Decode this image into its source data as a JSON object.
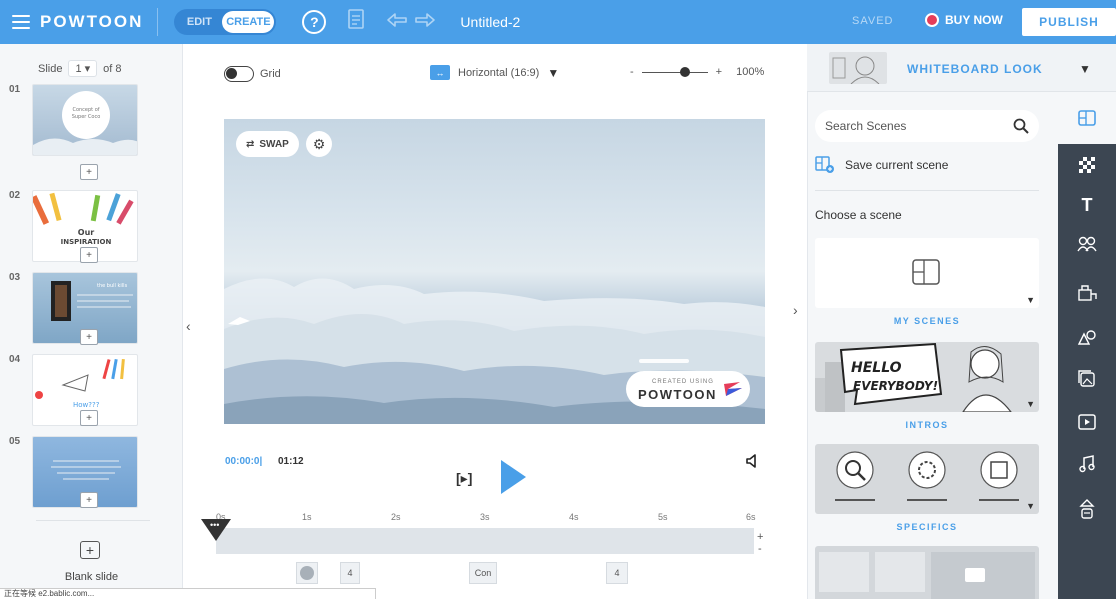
{
  "topbar": {
    "logo": "POWTOON",
    "mode_edit": "EDIT",
    "mode_create": "CREATE",
    "help": "?",
    "title": "Untitled-2",
    "saved": "SAVED",
    "buy_now": "BUY NOW",
    "publish": "PUBLISH"
  },
  "slides_panel": {
    "label": "Slide",
    "current": "1",
    "total": "of 8",
    "slides": [
      {
        "num": "01",
        "text": "Concept of Super Coco"
      },
      {
        "num": "02",
        "text": "Our INSPIRATION"
      },
      {
        "num": "03",
        "text": "the bull kills"
      },
      {
        "num": "04",
        "text": "How???"
      },
      {
        "num": "05",
        "text": ""
      }
    ],
    "blank_slide": "Blank slide"
  },
  "canvas": {
    "grid_label": "Grid",
    "orientation": "Horizontal (16:9)",
    "zoom_minus": "-",
    "zoom_plus": "+",
    "zoom_value": "100%",
    "swap_label": "SWAP",
    "watermark_top": "CREATED USING",
    "watermark_main": "POWTOON"
  },
  "playback": {
    "current_time": "00:00:0|",
    "total_time": "01:12",
    "preview": "[▸]"
  },
  "timeline": {
    "ticks": [
      "0s",
      "1s",
      "2s",
      "3s",
      "4s",
      "5s",
      "6s"
    ],
    "plus": "+",
    "minus": "-",
    "items": [
      "",
      "4",
      "Con",
      "4"
    ]
  },
  "status_bar": "正在等候 e2.bablic.com...",
  "scenes_panel": {
    "look": "WHITEBOARD LOOK",
    "search_placeholder": "Search Scenes",
    "save_scene": "Save current scene",
    "choose": "Choose a scene",
    "categories": [
      "MY SCENES",
      "INTROS",
      "SPECIFICS"
    ],
    "intro_text_1": "HELLO",
    "intro_text_2": "EVERYBODY!"
  },
  "toolbar_icons": [
    "scenes-icon",
    "backgrounds-icon",
    "text-icon",
    "characters-icon",
    "props-icon",
    "shapes-icon",
    "images-icon",
    "video-icon",
    "music-icon",
    "transitions-icon"
  ],
  "colors": {
    "accent": "#4a9fe8",
    "toolbar_dark": "#3c4652",
    "buy_dot": "#e53d5a"
  }
}
